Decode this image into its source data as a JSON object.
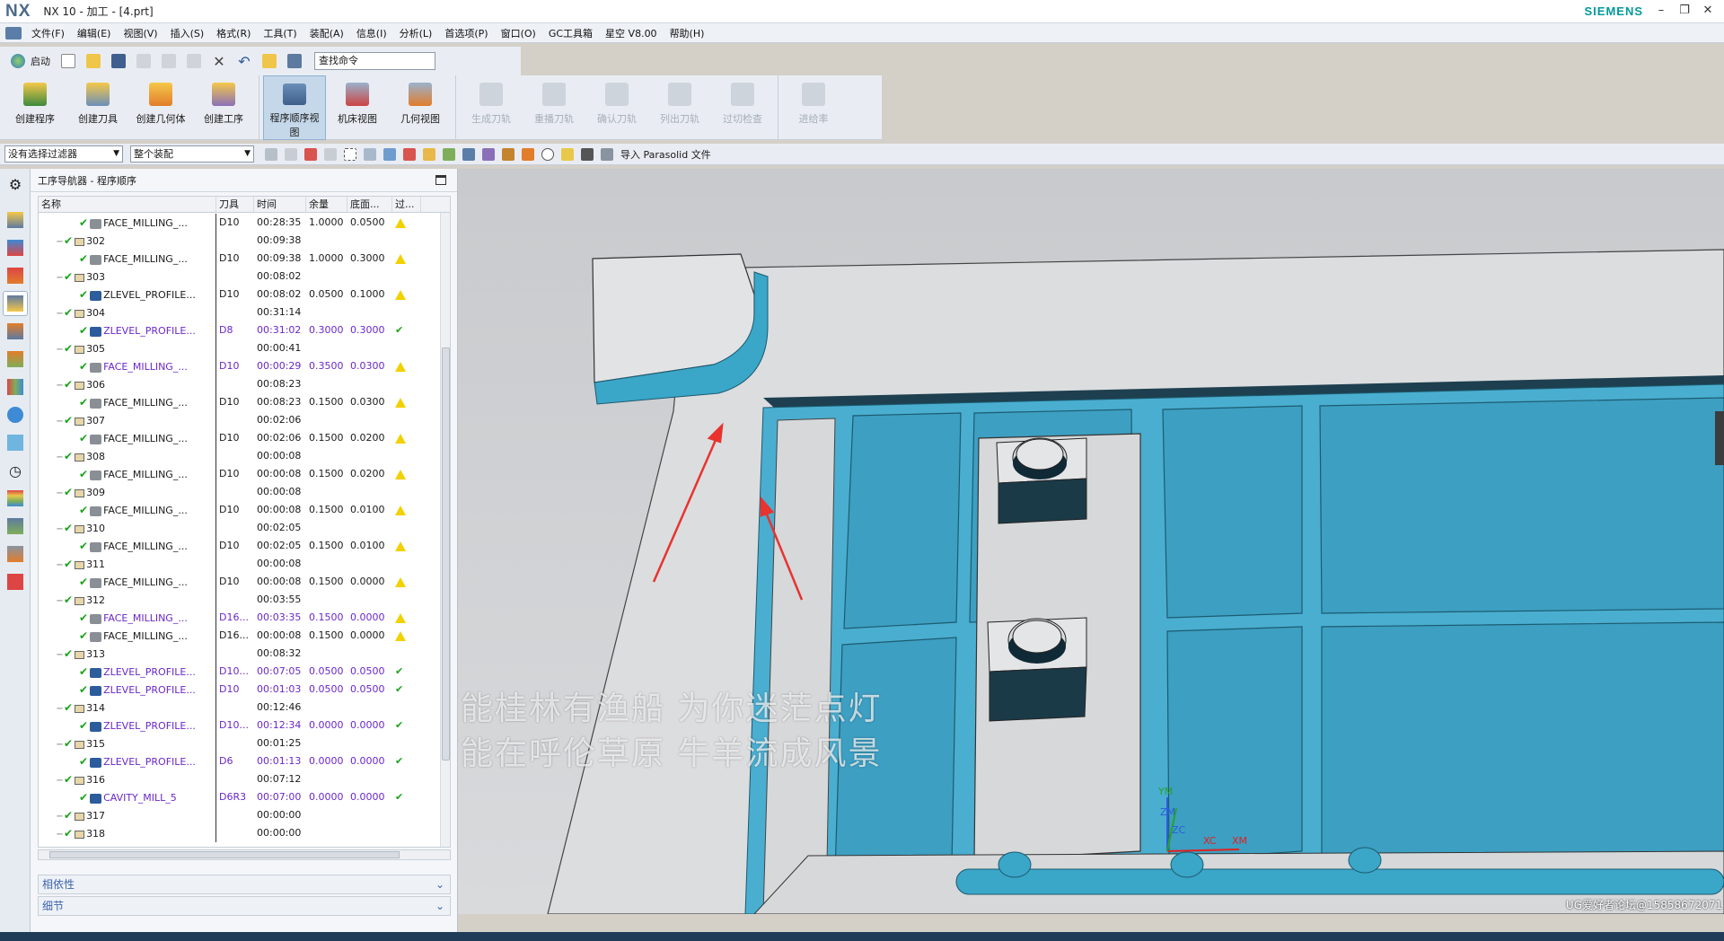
{
  "title": {
    "logo": "NX",
    "window_title": "NX 10 - 加工 - [4.prt]",
    "brand": "SIEMENS"
  },
  "menu": [
    "文件(F)",
    "编辑(E)",
    "视图(V)",
    "插入(S)",
    "格式(R)",
    "工具(T)",
    "装配(A)",
    "信息(I)",
    "分析(L)",
    "首选项(P)",
    "窗口(O)",
    "GC工具箱",
    "星空 V8.00",
    "帮助(H)"
  ],
  "toolbar": {
    "start_label": "启动",
    "search_placeholder": "查找命令"
  },
  "ribbon": {
    "create": [
      "创建程序",
      "创建刀具",
      "创建几何体",
      "创建工序"
    ],
    "views": [
      "程序顺序视图",
      "机床视图",
      "几何视图"
    ],
    "ops": [
      "生成刀轨",
      "重播刀轨",
      "确认刀轨",
      "列出刀轨",
      "过切检查",
      "进给率"
    ]
  },
  "filterbar": {
    "selection_filter": "没有选择过滤器",
    "assembly": "整个装配",
    "import_label": "导入 Parasolid 文件"
  },
  "navigator": {
    "title": "工序导航器 - 程序顺序",
    "columns": [
      "名称",
      "刀具",
      "时间",
      "余量",
      "底面...",
      "过..."
    ],
    "rows": [
      {
        "type": "op",
        "name": "FACE_MILLING_...",
        "tool": "D10",
        "time": "00:28:35",
        "stock": "1.0000",
        "floor": "0.0500",
        "status": "warn",
        "purple": false
      },
      {
        "type": "group",
        "name": "302",
        "time": "00:09:38"
      },
      {
        "type": "op",
        "name": "FACE_MILLING_...",
        "tool": "D10",
        "time": "00:09:38",
        "stock": "1.0000",
        "floor": "0.3000",
        "status": "warn",
        "purple": false
      },
      {
        "type": "group",
        "name": "303",
        "time": "00:08:02"
      },
      {
        "type": "op",
        "name": "ZLEVEL_PROFILE...",
        "tool": "D10",
        "time": "00:08:02",
        "stock": "0.0500",
        "floor": "0.1000",
        "status": "warn",
        "purple": false
      },
      {
        "type": "group",
        "name": "304",
        "time": "00:31:14"
      },
      {
        "type": "op",
        "name": "ZLEVEL_PROFILE...",
        "tool": "D8",
        "time": "00:31:02",
        "stock": "0.3000",
        "floor": "0.3000",
        "status": "ok",
        "purple": true
      },
      {
        "type": "group",
        "name": "305",
        "time": "00:00:41"
      },
      {
        "type": "op",
        "name": "FACE_MILLING_...",
        "tool": "D10",
        "time": "00:00:29",
        "stock": "0.3500",
        "floor": "0.0300",
        "status": "warn",
        "purple": true
      },
      {
        "type": "group",
        "name": "306",
        "time": "00:08:23"
      },
      {
        "type": "op",
        "name": "FACE_MILLING_...",
        "tool": "D10",
        "time": "00:08:23",
        "stock": "0.1500",
        "floor": "0.0300",
        "status": "warn",
        "purple": false
      },
      {
        "type": "group",
        "name": "307",
        "time": "00:02:06"
      },
      {
        "type": "op",
        "name": "FACE_MILLING_...",
        "tool": "D10",
        "time": "00:02:06",
        "stock": "0.1500",
        "floor": "0.0200",
        "status": "warn",
        "purple": false
      },
      {
        "type": "group",
        "name": "308",
        "time": "00:00:08"
      },
      {
        "type": "op",
        "name": "FACE_MILLING_...",
        "tool": "D10",
        "time": "00:00:08",
        "stock": "0.1500",
        "floor": "0.0200",
        "status": "warn",
        "purple": false
      },
      {
        "type": "group",
        "name": "309",
        "time": "00:00:08"
      },
      {
        "type": "op",
        "name": "FACE_MILLING_...",
        "tool": "D10",
        "time": "00:00:08",
        "stock": "0.1500",
        "floor": "0.0100",
        "status": "warn",
        "purple": false
      },
      {
        "type": "group",
        "name": "310",
        "time": "00:02:05"
      },
      {
        "type": "op",
        "name": "FACE_MILLING_...",
        "tool": "D10",
        "time": "00:02:05",
        "stock": "0.1500",
        "floor": "0.0100",
        "status": "warn",
        "purple": false
      },
      {
        "type": "group",
        "name": "311",
        "time": "00:00:08"
      },
      {
        "type": "op",
        "name": "FACE_MILLING_...",
        "tool": "D10",
        "time": "00:00:08",
        "stock": "0.1500",
        "floor": "0.0000",
        "status": "warn",
        "purple": false
      },
      {
        "type": "group",
        "name": "312",
        "time": "00:03:55"
      },
      {
        "type": "op",
        "name": "FACE_MILLING_...",
        "tool": "D16...",
        "time": "00:03:35",
        "stock": "0.1500",
        "floor": "0.0000",
        "status": "warn",
        "purple": true
      },
      {
        "type": "op",
        "name": "FACE_MILLING_...",
        "tool": "D16...",
        "time": "00:00:08",
        "stock": "0.1500",
        "floor": "0.0000",
        "status": "warn",
        "purple": false
      },
      {
        "type": "group",
        "name": "313",
        "time": "00:08:32"
      },
      {
        "type": "op",
        "name": "ZLEVEL_PROFILE...",
        "tool": "D10...",
        "time": "00:07:05",
        "stock": "0.0500",
        "floor": "0.0500",
        "status": "ok",
        "purple": true
      },
      {
        "type": "op",
        "name": "ZLEVEL_PROFILE...",
        "tool": "D10",
        "time": "00:01:03",
        "stock": "0.0500",
        "floor": "0.0500",
        "status": "ok",
        "purple": true
      },
      {
        "type": "group",
        "name": "314",
        "time": "00:12:46"
      },
      {
        "type": "op",
        "name": "ZLEVEL_PROFILE...",
        "tool": "D10...",
        "time": "00:12:34",
        "stock": "0.0000",
        "floor": "0.0000",
        "status": "ok",
        "purple": true
      },
      {
        "type": "group",
        "name": "315",
        "time": "00:01:25"
      },
      {
        "type": "op",
        "name": "ZLEVEL_PROFILE...",
        "tool": "D6",
        "time": "00:01:13",
        "stock": "0.0000",
        "floor": "0.0000",
        "status": "ok",
        "purple": true
      },
      {
        "type": "group",
        "name": "316",
        "time": "00:07:12"
      },
      {
        "type": "op",
        "name": "CAVITY_MILL_5",
        "tool": "D6R3",
        "time": "00:07:00",
        "stock": "0.0000",
        "floor": "0.0000",
        "status": "ok",
        "purple": true
      },
      {
        "type": "group",
        "name": "317",
        "time": "00:00:00"
      },
      {
        "type": "group",
        "name": "318",
        "time": "00:00:00"
      }
    ],
    "dependency_label": "相依性",
    "details_label": "细节"
  },
  "viewport": {
    "overlay_line1": "可能桂林有渔船 为你迷茫点灯",
    "overlay_line2": "可能在呼伦草原 牛羊流成风景",
    "axis_labels": [
      "YM",
      "ZM",
      "ZC",
      "XC",
      "XM"
    ],
    "watermark": "UG爱好者论坛@15858672071",
    "model_color": "#4aaed0"
  }
}
